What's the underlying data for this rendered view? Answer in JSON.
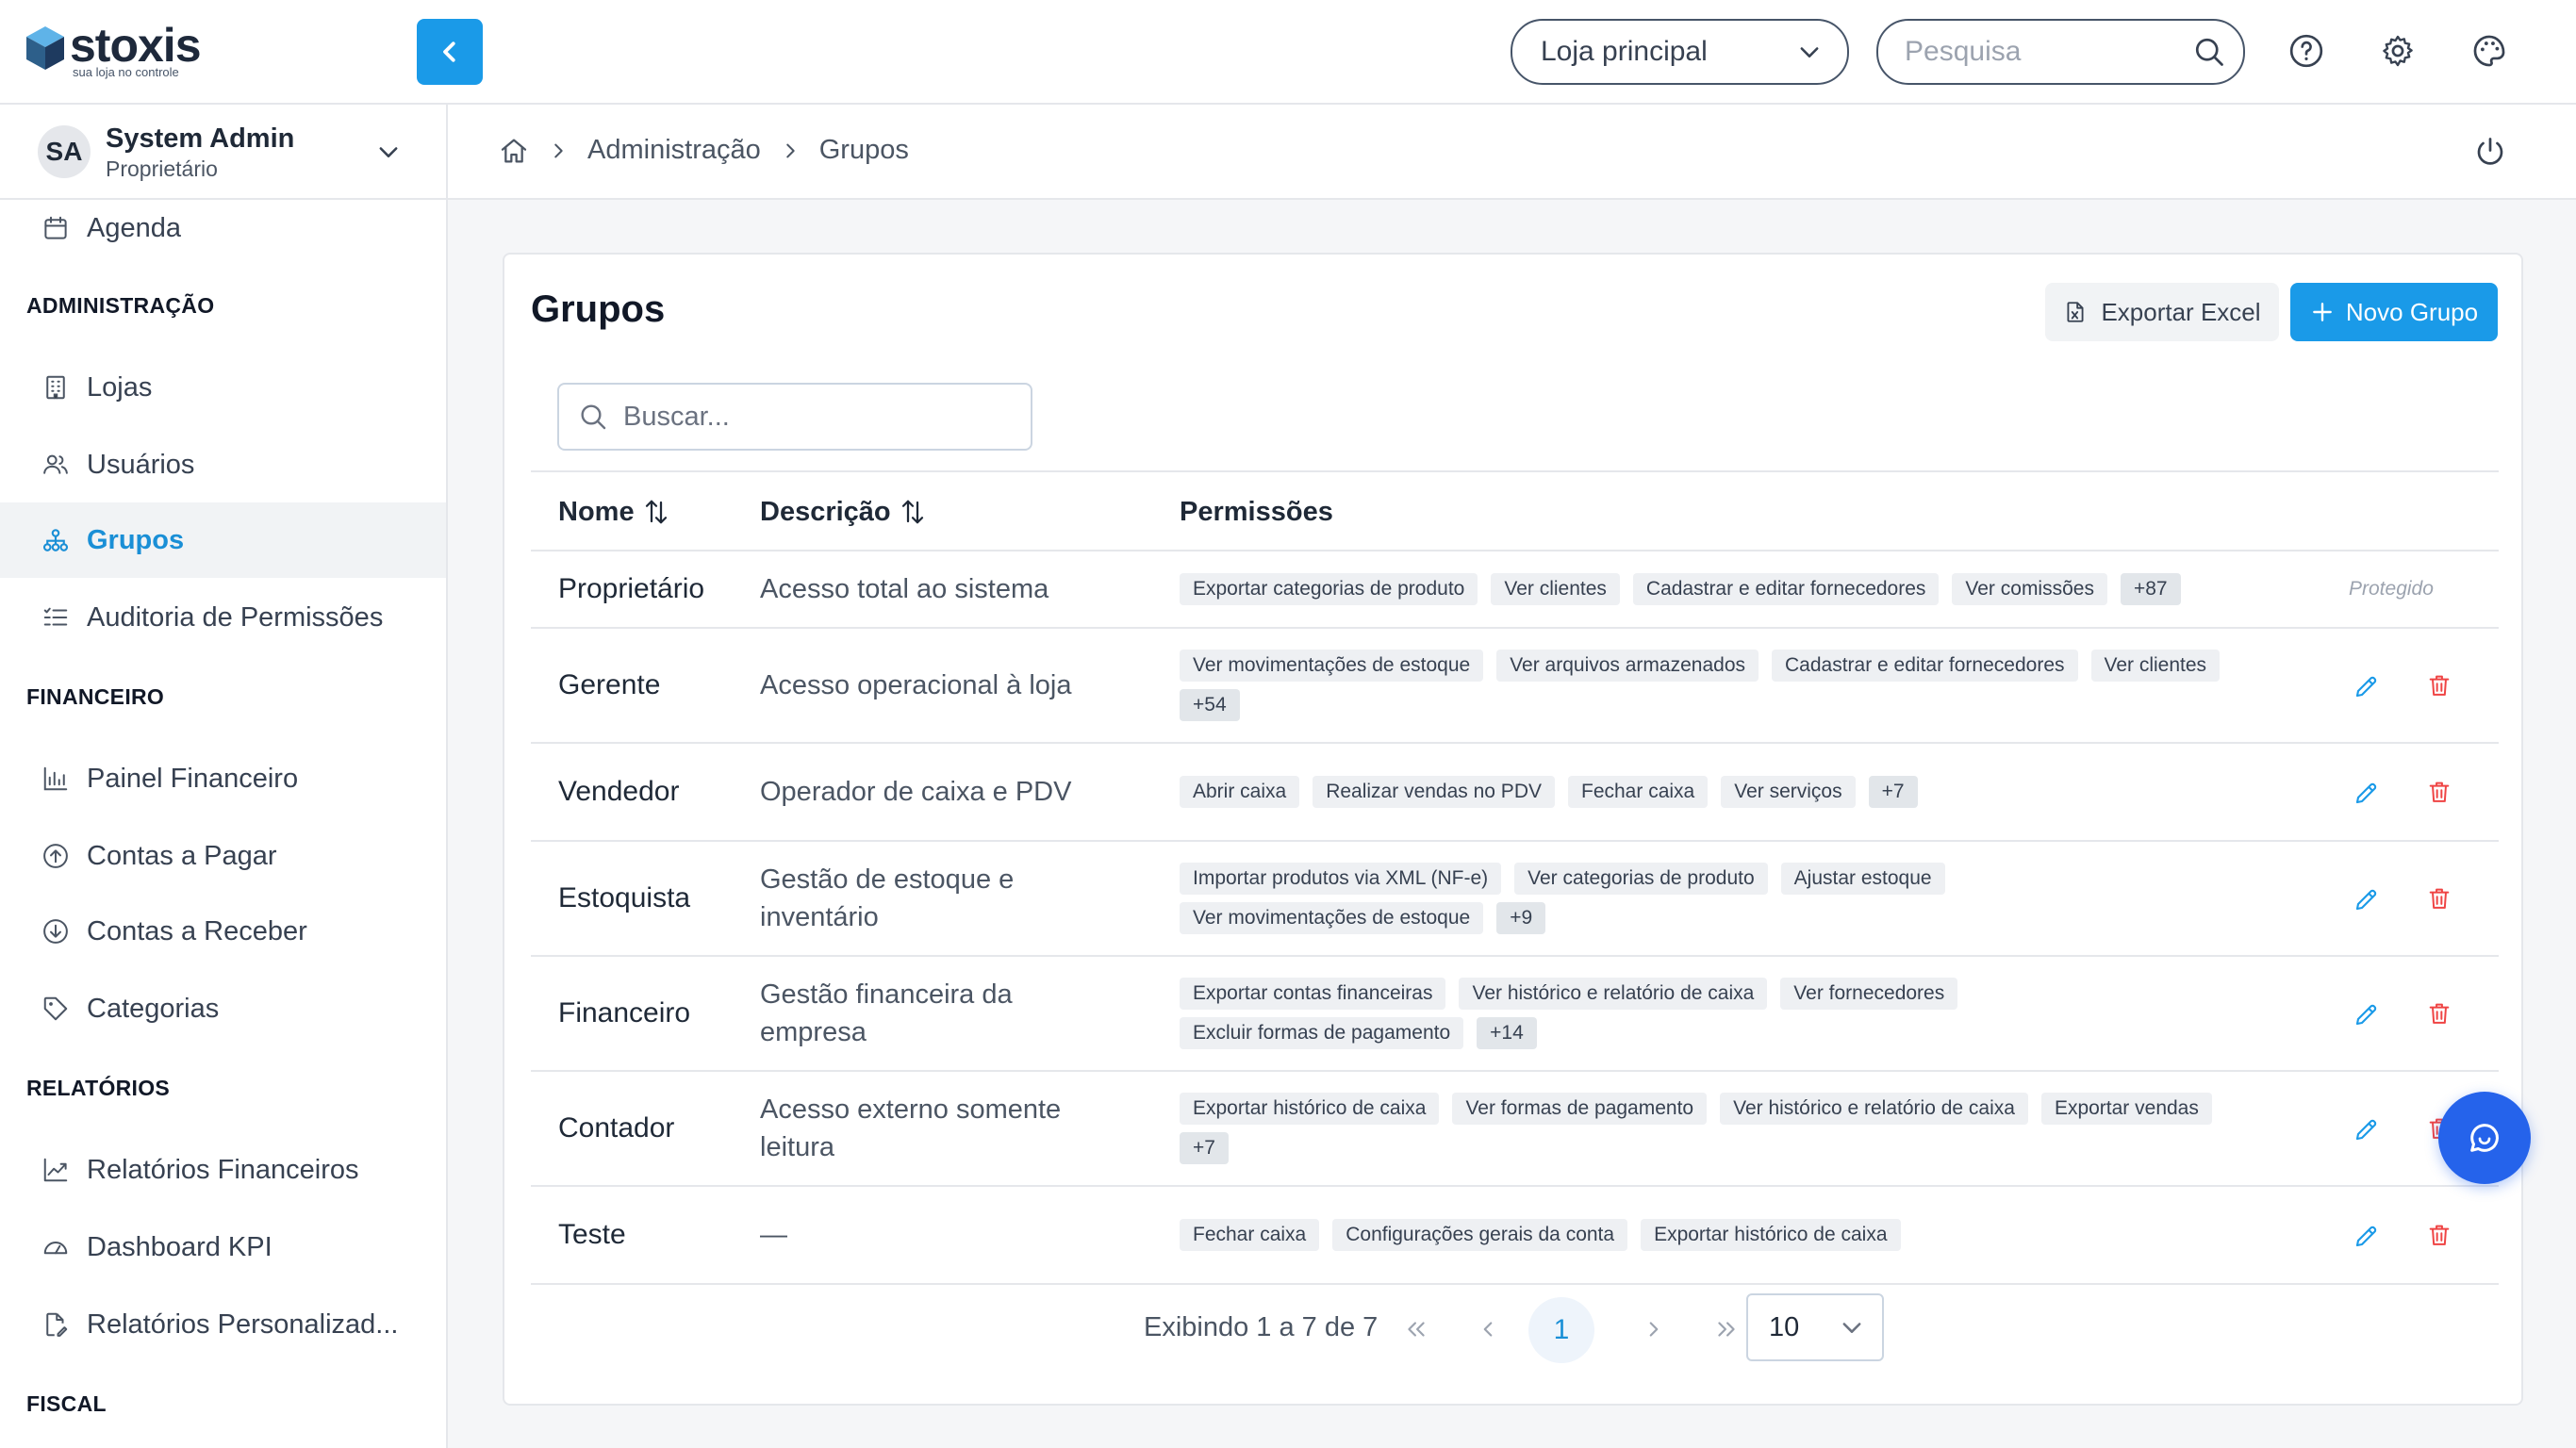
{
  "brand": {
    "name": "stoxis",
    "tagline": "sua loja no controle"
  },
  "topbar": {
    "store_select": "Loja principal",
    "search_placeholder": "Pesquisa"
  },
  "user": {
    "initials": "SA",
    "name": "System Admin",
    "role": "Proprietário"
  },
  "sidebar": {
    "agenda": "Agenda",
    "sections": {
      "admin": "ADMINISTRAÇÃO",
      "financeiro": "FINANCEIRO",
      "relatorios": "RELATÓRIOS",
      "fiscal": "FISCAL"
    },
    "admin_items": [
      "Lojas",
      "Usuários",
      "Grupos",
      "Auditoria de Permissões"
    ],
    "fin_items": [
      "Painel Financeiro",
      "Contas a Pagar",
      "Contas a Receber",
      "Categorias"
    ],
    "rel_items": [
      "Relatórios Financeiros",
      "Dashboard KPI",
      "Relatórios Personalizad..."
    ]
  },
  "breadcrumb": {
    "items": [
      "Administração",
      "Grupos"
    ]
  },
  "page": {
    "title": "Grupos",
    "export_label": "Exportar Excel",
    "new_label": "Novo Grupo",
    "search_placeholder": "Buscar..."
  },
  "table": {
    "headers": {
      "name": "Nome",
      "description": "Descrição",
      "permissions": "Permissões"
    },
    "protected_label": "Protegido",
    "rows": [
      {
        "name": "Proprietário",
        "description": "Acesso total ao sistema",
        "permissions": [
          "Exportar categorias de produto",
          "Ver clientes",
          "Cadastrar e editar fornecedores",
          "Ver comissões"
        ],
        "more": "+87",
        "protected": true
      },
      {
        "name": "Gerente",
        "description": "Acesso operacional à loja",
        "permissions": [
          "Ver movimentações de estoque",
          "Ver arquivos armazenados",
          "Cadastrar e editar fornecedores",
          "Ver clientes"
        ],
        "more": "+54",
        "protected": false
      },
      {
        "name": "Vendedor",
        "description": "Operador de caixa e PDV",
        "permissions": [
          "Abrir caixa",
          "Realizar vendas no PDV",
          "Fechar caixa",
          "Ver serviços"
        ],
        "more": "+7",
        "protected": false
      },
      {
        "name": "Estoquista",
        "description": "Gestão de estoque e inventário",
        "permissions": [
          "Importar produtos via XML (NF-e)",
          "Ver categorias de produto",
          "Ajustar estoque",
          "Ver movimentações de estoque"
        ],
        "more": "+9",
        "protected": false
      },
      {
        "name": "Financeiro",
        "description": "Gestão financeira da empresa",
        "permissions": [
          "Exportar contas financeiras",
          "Ver histórico e relatório de caixa",
          "Ver fornecedores",
          "Excluir formas de pagamento"
        ],
        "more": "+14",
        "protected": false
      },
      {
        "name": "Contador",
        "description": "Acesso externo somente leitura",
        "permissions": [
          "Exportar histórico de caixa",
          "Ver formas de pagamento",
          "Ver histórico e relatório de caixa",
          "Exportar vendas"
        ],
        "more": "+7",
        "protected": false
      },
      {
        "name": "Teste",
        "description": "—",
        "permissions": [
          "Fechar caixa",
          "Configurações gerais da conta",
          "Exportar histórico de caixa"
        ],
        "more": "",
        "protected": false
      }
    ]
  },
  "pagination": {
    "info": "Exibindo 1 a 7 de 7",
    "current_page": "1",
    "page_size": "10"
  },
  "colors": {
    "accent": "#1a9ae8",
    "danger": "#ef4444",
    "fab": "#2563eb"
  }
}
